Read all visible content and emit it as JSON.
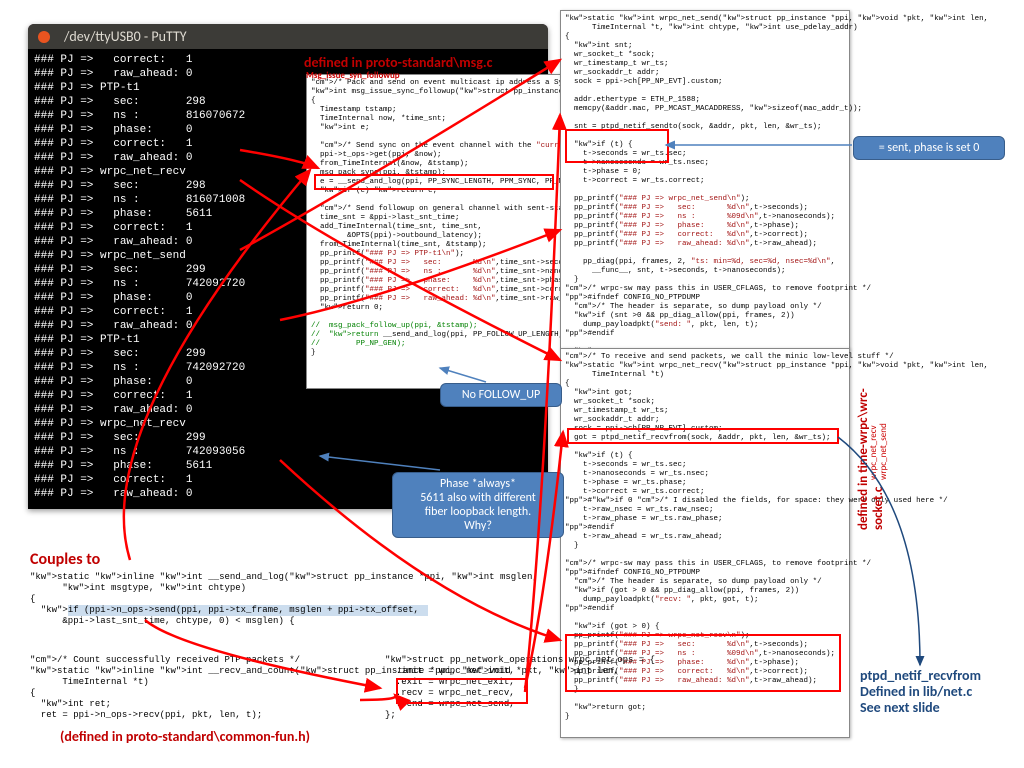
{
  "putty": {
    "title": "/dev/ttyUSB0 - PuTTY",
    "lines": [
      "### PJ =>   correct:   1",
      "### PJ =>   raw_ahead: 0",
      "### PJ => PTP-t1",
      "### PJ =>   sec:       298",
      "### PJ =>   ns :       816070672",
      "### PJ =>   phase:     0",
      "### PJ =>   correct:   1",
      "### PJ =>   raw_ahead: 0",
      "### PJ => wrpc_net_recv",
      "### PJ =>   sec:       298",
      "### PJ =>   ns :       816071008",
      "### PJ =>   phase:     5611",
      "### PJ =>   correct:   1",
      "### PJ =>   raw_ahead: 0",
      "### PJ => wrpc_net_send",
      "### PJ =>   sec:       299",
      "### PJ =>   ns :       742092720",
      "### PJ =>   phase:     0",
      "### PJ =>   correct:   1",
      "### PJ =>   raw_ahead: 0",
      "### PJ => PTP-t1",
      "### PJ =>   sec:       299",
      "### PJ =>   ns :       742092720",
      "### PJ =>   phase:     0",
      "### PJ =>   correct:   1",
      "### PJ =>   raw_ahead: 0",
      "### PJ => wrpc_net_recv",
      "### PJ =>   sec:       299",
      "### PJ =>   ns :       742093056",
      "### PJ =>   phase:     5611",
      "### PJ =>   correct:   1",
      "### PJ =>   raw_ahead: 0"
    ]
  },
  "annot_top_red": "defined in proto-standard\\msg.c",
  "annot_top_sub": "Msg_issue_syn_followup",
  "callout1": "= sent, phase is set 0",
  "callout2": "No FOLLOW_UP",
  "callout3_l1": "Phase *always*",
  "callout3_l2": "5611 also with different",
  "callout3_l3": "fiber loopback length.",
  "callout3_l4": "Why?",
  "couples_to": "Couples to",
  "lower_defined": "(defined in proto-standard\\common-fun.h)",
  "side_label": "defined in time-wrpc\\wrc-socket.c",
  "side_label_sub1": "wrpc_net_recv",
  "side_label_sub2": "wrpc_net_send",
  "blue_ann_l1": "ptpd_netif_recvfrom",
  "blue_ann_l2": "Defined in lib/net.c",
  "blue_ann_l3": "See next slide",
  "code_top": "/* Pack and send on event multicast ip address a Sync message */\nint msg_issue_sync_followup(struct pp_instance *ppi)\n{\n  Timestamp tstamp;\n  TimeInternal now, *time_snt;\n  int e;\n\n  /* Send sync on the event channel with the \"current\" timestamp */\n  ppi->t_ops->get(ppi, &now);\n  from_TimeInternal(&now, &tstamp);\n  msg_pack_sync(ppi, &tstamp);\n  e = __send_and_log(ppi, PP_SYNC_LENGTH, PPM_SYNC, PP_NP_EVT);\n  if (e) return e;\n\n  /* Send followup on general channel with sent-stamp of sync */\n  time_snt = &ppi->last_snt_time;\n  add_TimeInternal(time_snt, time_snt,\n        &OPTS(ppi)->outbound_latency);\n  from_TimeInternal(time_snt, &tstamp);\n  pp_printf(\"### PJ => PTP-t1\\n\");\n  pp_printf(\"### PJ =>   sec:       %d\\n\",time_snt->seconds);\n  pp_printf(\"### PJ =>   ns :       %d\\n\",time_snt->nanoseconds);\n  pp_printf(\"### PJ =>   phase:     %d\\n\",time_snt->phase);\n  pp_printf(\"### PJ =>   correct:   %d\\n\",time_snt->correct);\n  pp_printf(\"### PJ =>   raw_ahead: %d\\n\",time_snt->raw_ahead);\n  return 0;\n\n//  msg_pack_follow_up(ppi, &tstamp);\n//  return __send_and_log(ppi, PP_FOLLOW_UP_LENGTH, PPM_FOLLOW_UP,\n//        PP_NP_GEN);\n}",
  "code_right_send": "static int wrpc_net_send(struct pp_instance *ppi, void *pkt, int len,\n      TimeInternal *t, int chtype, int use_pdelay_addr)\n{\n  int snt;\n  wr_socket_t *sock;\n  wr_timestamp_t wr_ts;\n  wr_sockaddr_t addr;\n  sock = ppi->ch[PP_NP_EVT].custom;\n\n  addr.ethertype = ETH_P_1588;\n  memcpy(&addr.mac, PP_MCAST_MACADDRESS, sizeof(mac_addr_t));\n\n  snt = ptpd_netif_sendto(sock, &addr, pkt, len, &wr_ts);\n\n  if (t) {\n    t->seconds = wr_ts.sec;\n    t->nanoseconds = wr_ts.nsec;\n    t->phase = 0;\n    t->correct = wr_ts.correct;\n\n  pp_printf(\"### PJ => wrpc_net_send\\n\");\n  pp_printf(\"### PJ =>   sec:       %d\\n\",t->seconds);\n  pp_printf(\"### PJ =>   ns :       %09d\\n\",t->nanoseconds);\n  pp_printf(\"### PJ =>   phase:     %d\\n\",t->phase);\n  pp_printf(\"### PJ =>   correct:   %d\\n\",t->correct);\n  pp_printf(\"### PJ =>   raw_ahead: %d\\n\",t->raw_ahead);\n\n    pp_diag(ppi, frames, 2, \"ts: min=%d, sec=%d, nsec=%d\\n\",\n      __func__, snt, t->seconds, t->nanoseconds);\n  }\n/* wrpc-sw may pass this in USER_CFLAGS, to remove footprint */\n#ifndef CONFIG_NO_PTPDUMP\n  /* The header is separate, so dump payload only */\n  if (snt >0 && pp_diag_allow(ppi, frames, 2))\n    dump_payloadpkt(\"send: \", pkt, len, t);\n#endif\n\n  return snt;\n}",
  "code_right_recv": "/* To receive and send packets, we call the minic low-level stuff */\nstatic int wrpc_net_recv(struct pp_instance *ppi, void *pkt, int len,\n      TimeInternal *t)\n{\n  int got;\n  wr_socket_t *sock;\n  wr_timestamp_t wr_ts;\n  wr_sockaddr_t addr;\n  sock = ppi->ch[PP_NP_EVT].custom;\n  got = ptpd_netif_recvfrom(sock, &addr, pkt, len, &wr_ts);\n\n  if (t) {\n    t->seconds = wr_ts.sec;\n    t->nanoseconds = wr_ts.nsec;\n    t->phase = wr_ts.phase;\n    t->correct = wr_ts.correct;\n#if 0 /* I disabled the fields, for space: they were only used here */\n    t->raw_nsec = wr_ts.raw_nsec;\n    t->raw_phase = wr_ts.raw_phase;\n#endif\n    t->raw_ahead = wr_ts.raw_ahead;\n  }\n\n/* wrpc-sw may pass this in USER_CFLAGS, to remove footprint */\n#ifndef CONFIG_NO_PTPDUMP\n  /* The header is separate, so dump payload only */\n  if (got > 0 && pp_diag_allow(ppi, frames, 2))\n    dump_payloadpkt(\"recv: \", pkt, got, t);\n#endif\n\n  if (got > 0) {\n  pp_printf(\"### PJ => wrpc_net_recv\\n\");\n  pp_printf(\"### PJ =>   sec:       %d\\n\",t->seconds);\n  pp_printf(\"### PJ =>   ns :       %09d\\n\",t->nanoseconds);\n  pp_printf(\"### PJ =>   phase:     %d\\n\",t->phase);\n  pp_printf(\"### PJ =>   correct:   %d\\n\",t->correct);\n  pp_printf(\"### PJ =>   raw_ahead: %d\\n\",t->raw_ahead);\n  }\n\n  return got;\n}",
  "snip_send_and_log": "static inline int __send_and_log(struct pp_instance *ppi, int msglen,\n      int msgtype, int chtype)\n{\n  if (ppi->n_ops->send(ppi, ppi->tx_frame, msglen + ppi->tx_offset,\n      &ppi->last_snt_time, chtype, 0) < msglen) {",
  "snip_recv_and_count": "/* Count successfully received PTP packets */\nstatic inline int __recv_and_count(struct pp_instance *ppi, void *pkt, int len,\n      TimeInternal *t)\n{\n  int ret;\n  ret = ppi->n_ops->recv(ppi, pkt, len, t);",
  "snip_ops": "struct pp_network_operations wrpc_net_ops = {\n  .init = wrpc_net_init,\n  .exit = wrpc_net_exit,\n  .recv = wrpc_net_recv,\n  .send = wrpc_net_send,\n};"
}
